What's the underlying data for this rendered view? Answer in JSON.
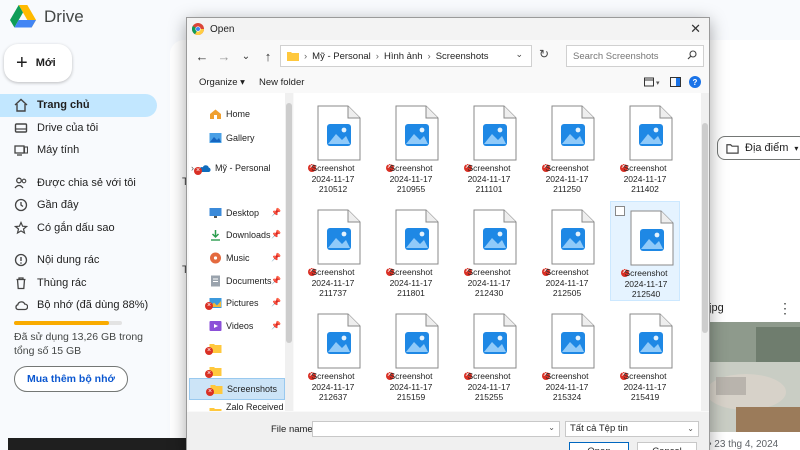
{
  "drive": {
    "app_title": "Drive",
    "new_label": "Mới",
    "nav": [
      {
        "label": "Trang chủ",
        "icon": "home-icon",
        "active": true
      },
      {
        "label": "Drive của tôi",
        "icon": "drive-icon"
      },
      {
        "label": "Máy tính",
        "icon": "computer-icon"
      },
      {
        "label": "Được chia sẻ với tôi",
        "icon": "people-icon"
      },
      {
        "label": "Gần đây",
        "icon": "clock-icon"
      },
      {
        "label": "Có gắn dấu sao",
        "icon": "star-icon"
      },
      {
        "label": "Nội dung rác",
        "icon": "spam-icon"
      },
      {
        "label": "Thùng rác",
        "icon": "trash-icon"
      },
      {
        "label": "Bộ nhớ (đã dùng 88%)",
        "icon": "cloud-icon"
      }
    ],
    "storage_used_fraction": 0.88,
    "storage_text": "Đã sử dụng 13,26 GB trong tổng số 15 GB",
    "buy_storage_label": "Mua thêm bộ nhớ",
    "location_filter": "Địa điểm",
    "card_filename_fragment": ".jpg",
    "card_date": "• 23 thg 4, 2024",
    "colors": {
      "active_nav": "#c2e7ff",
      "accent_blue": "#0b57d0",
      "storage_fill": "#f9ab00"
    }
  },
  "dialog": {
    "title": "Open",
    "breadcrumb": [
      "Mỹ - Personal",
      "Hình ảnh",
      "Screenshots"
    ],
    "search_placeholder": "Search Screenshots",
    "organize_label": "Organize ▾",
    "new_folder_label": "New folder",
    "nav_pane": [
      {
        "label": "Home",
        "icon": "home-icon"
      },
      {
        "label": "Gallery",
        "icon": "gallery-icon"
      },
      {
        "label": "Mỹ - Personal",
        "icon": "onedrive-cloud-icon",
        "error": true,
        "expand": true
      },
      {
        "label": "",
        "icon": "spacer"
      },
      {
        "label": "Desktop",
        "icon": "desktop-icon",
        "pinned": true
      },
      {
        "label": "Downloads",
        "icon": "downloads-icon",
        "pinned": true
      },
      {
        "label": "Music",
        "icon": "music-icon",
        "pinned": true
      },
      {
        "label": "Documents",
        "icon": "documents-icon",
        "pinned": true
      },
      {
        "label": "Pictures",
        "icon": "pictures-icon",
        "pinned": true,
        "error": true
      },
      {
        "label": "Videos",
        "icon": "videos-icon",
        "pinned": true
      },
      {
        "label": "",
        "icon": "folder-icon",
        "error": true
      },
      {
        "label": "",
        "icon": "folder-icon",
        "error": true
      },
      {
        "label": "Screenshots",
        "icon": "folder-icon",
        "error": true,
        "selected": true
      },
      {
        "label": "Zalo Received Fi",
        "icon": "folder-icon"
      }
    ],
    "files": [
      {
        "line1": "Screenshot",
        "line2": "2024-11-17",
        "line3": "210512"
      },
      {
        "line1": "Screenshot",
        "line2": "2024-11-17",
        "line3": "210955"
      },
      {
        "line1": "Screenshot",
        "line2": "2024-11-17",
        "line3": "211101"
      },
      {
        "line1": "Screenshot",
        "line2": "2024-11-17",
        "line3": "211250"
      },
      {
        "line1": "Screenshot",
        "line2": "2024-11-17",
        "line3": "211402"
      },
      {
        "line1": "Screenshot",
        "line2": "2024-11-17",
        "line3": "211737"
      },
      {
        "line1": "Screenshot",
        "line2": "2024-11-17",
        "line3": "211801"
      },
      {
        "line1": "Screenshot",
        "line2": "2024-11-17",
        "line3": "212430"
      },
      {
        "line1": "Screenshot",
        "line2": "2024-11-17",
        "line3": "212505"
      },
      {
        "line1": "Screenshot",
        "line2": "2024-11-17",
        "line3": "212540",
        "selected": true
      },
      {
        "line1": "Screenshot",
        "line2": "2024-11-17",
        "line3": "212637"
      },
      {
        "line1": "Screenshot",
        "line2": "2024-11-17",
        "line3": "215159"
      },
      {
        "line1": "Screenshot",
        "line2": "2024-11-17",
        "line3": "215255"
      },
      {
        "line1": "Screenshot",
        "line2": "2024-11-17",
        "line3": "215324"
      },
      {
        "line1": "Screenshot",
        "line2": "2024-11-17",
        "line3": "215419"
      }
    ],
    "filename_label": "File name:",
    "filename_value": "",
    "filetype_value": "Tất cả Tệp tin",
    "open_label": "Open",
    "cancel_label": "Cancel"
  }
}
